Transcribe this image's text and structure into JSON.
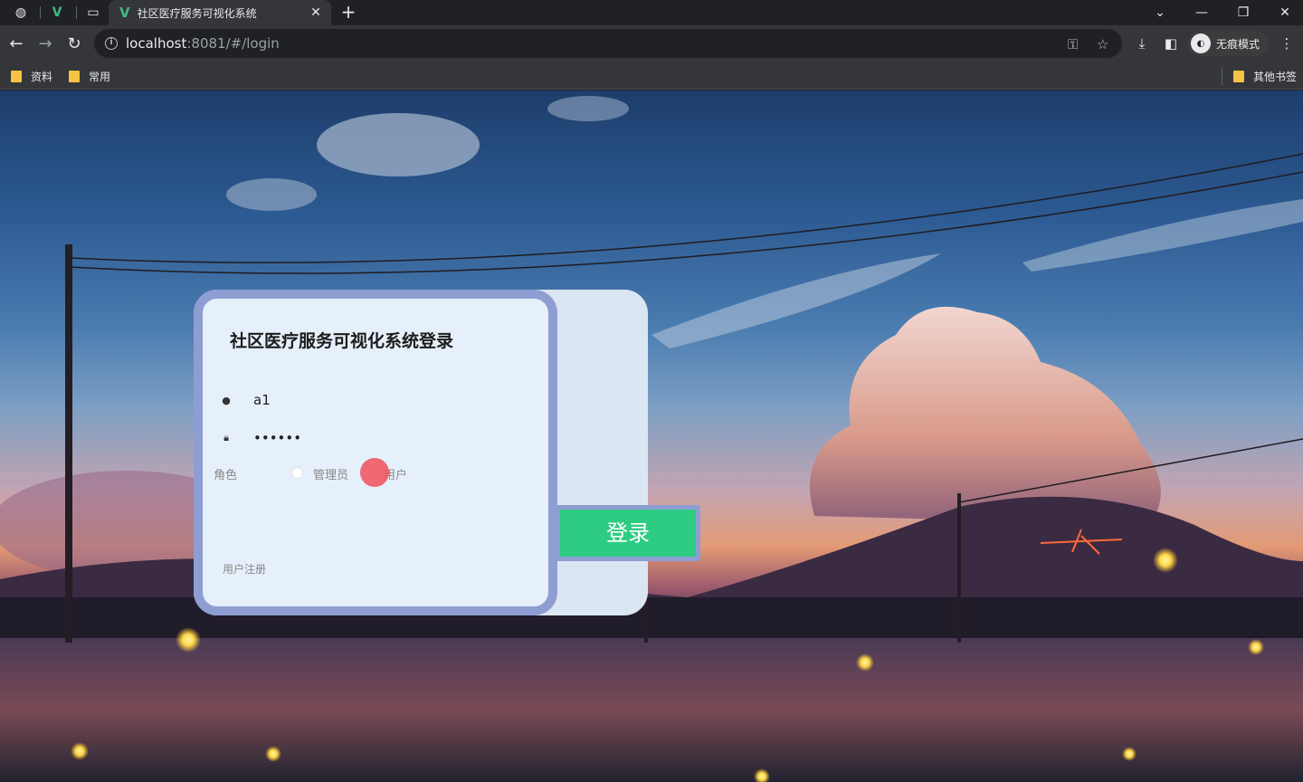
{
  "browser": {
    "tab_title": "社区医疗服务可视化系统",
    "url_host": "localhost",
    "url_rest": ":8081/#/login",
    "incognito_label": "无痕模式",
    "bookmarks": [
      "资料",
      "常用"
    ],
    "other_bookmarks": "其他书签"
  },
  "login": {
    "title": "社区医疗服务可视化系统登录",
    "username_value": "a1",
    "password_value": "••••••",
    "role_label": "角色",
    "roles": [
      "管理员",
      "用户"
    ],
    "login_button": "登录",
    "register_link": "用户注册"
  },
  "colors": {
    "card_border": "#8e9ed3",
    "card_bg": "#e6f0fb",
    "login_button": "#2ecc82"
  }
}
